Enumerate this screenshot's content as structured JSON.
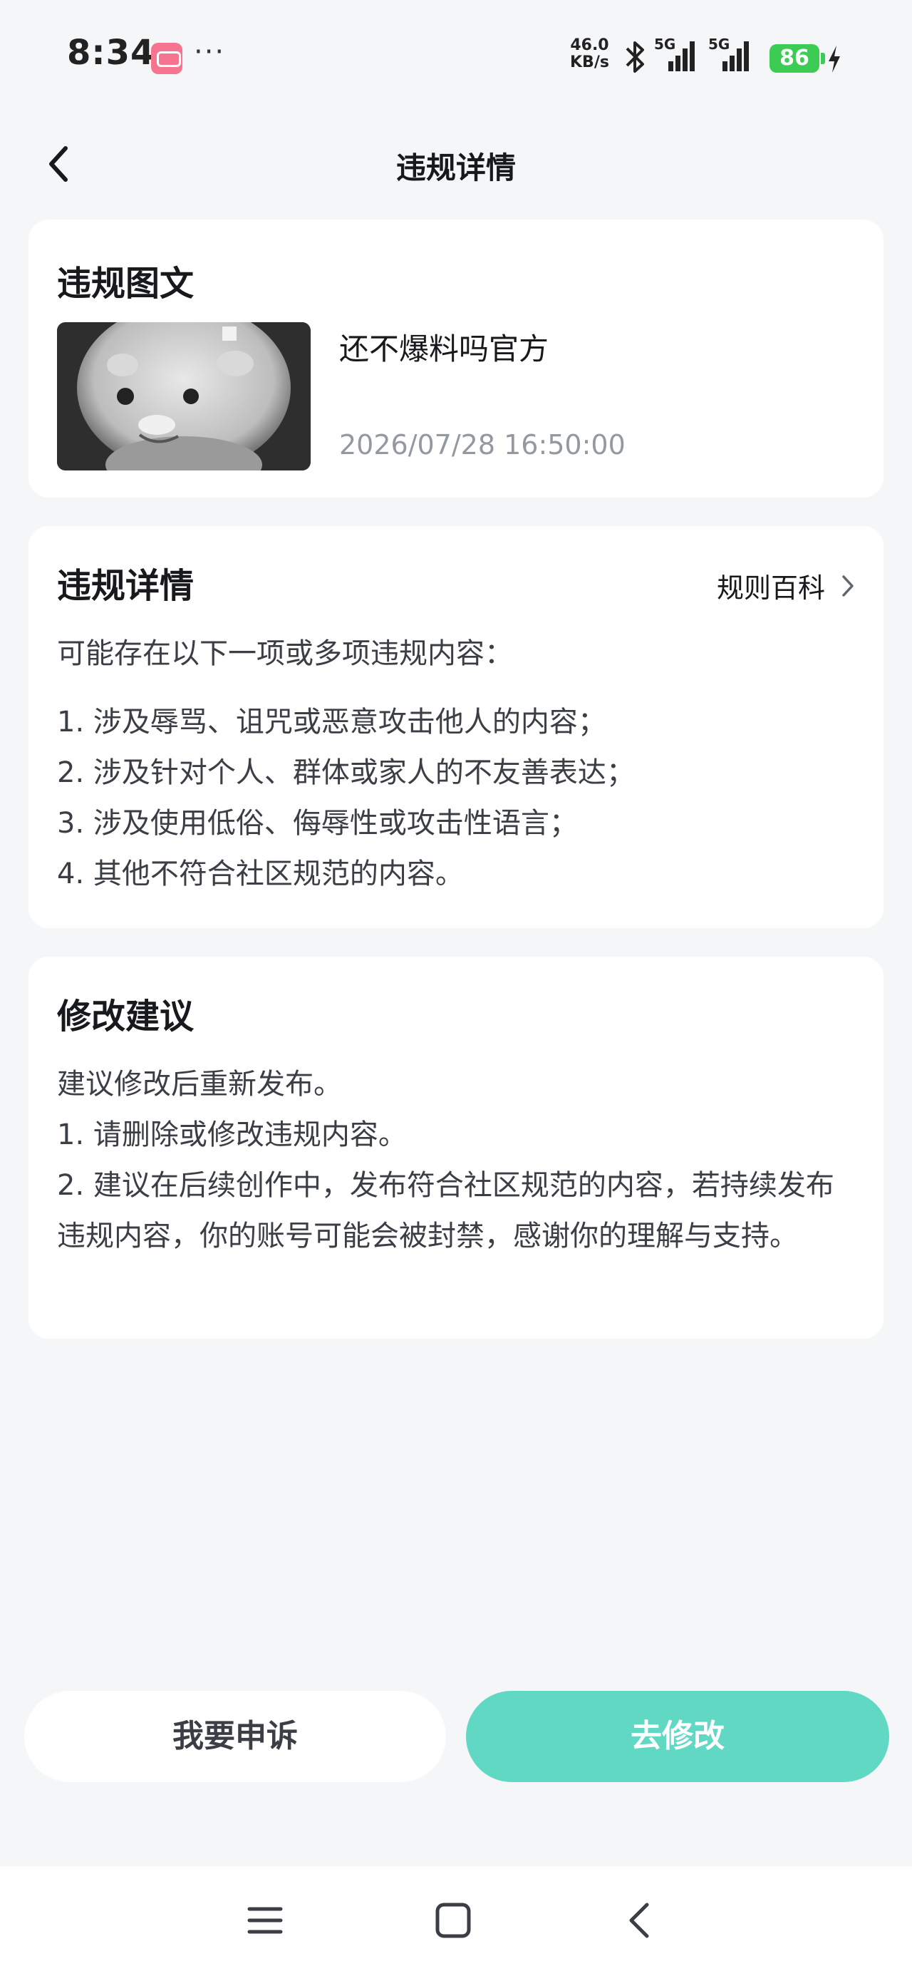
{
  "status_bar": {
    "time": "8:34",
    "app_icon": "bilibili-icon",
    "more": "···",
    "net_speed_value": "46.0",
    "net_speed_unit": "KB/s",
    "signal1_label": "5G",
    "signal2_label": "5G",
    "battery": "86"
  },
  "header": {
    "back_icon": "back-arrow-icon",
    "title": "违规详情"
  },
  "violation_post": {
    "section_title": "违规图文",
    "post_title": "还不爆料吗官方",
    "post_time": "2026/07/28 16:50:00"
  },
  "violation_details": {
    "section_title": "违规详情",
    "wiki_link": "规则百科",
    "intro": "可能存在以下一项或多项违规内容：",
    "rules": [
      "1. 涉及辱骂、诅咒或恶意攻击他人的内容；",
      "2. 涉及针对个人、群体或家人的不友善表达；",
      "3. 涉及使用低俗、侮辱性或攻击性语言；",
      "4. 其他不符合社区规范的内容。"
    ]
  },
  "suggestions": {
    "section_title": "修改建议",
    "lines": [
      "建议修改后重新发布。",
      "1. 请删除或修改违规内容。",
      "2. 建议在后续创作中，发布符合社区规范的内容，若持续发布违规内容，你的账号可能会被封禁，感谢你的理解与支持。"
    ]
  },
  "actions": {
    "appeal": "我要申诉",
    "edit": "去修改"
  },
  "system_nav": {
    "menu_icon": "menu-icon",
    "home_icon": "home-square-icon",
    "back_icon": "back-chevron-icon"
  },
  "colors": {
    "accent": "#61d8c3",
    "background": "#f5f6f8",
    "battery": "#3ccc53"
  }
}
